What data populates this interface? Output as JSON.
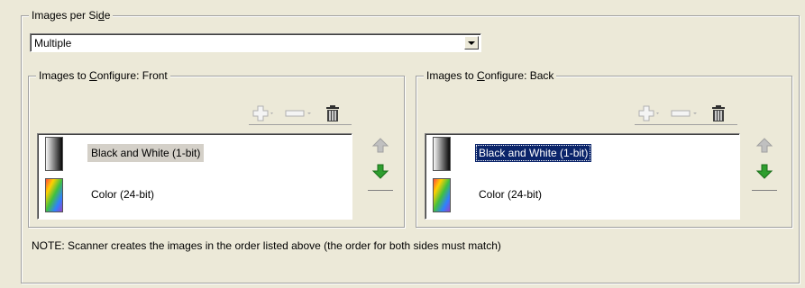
{
  "images_per_side": {
    "legend_prefix": "Images per Si",
    "legend_underline": "d",
    "legend_suffix": "e",
    "selected": "Multiple"
  },
  "front": {
    "legend_prefix": "Images to ",
    "legend_underline": "C",
    "legend_suffix": "onfigure: Front",
    "items": [
      {
        "label": "Black and White (1-bit)",
        "icon": "bw-image-icon"
      },
      {
        "label": "Color (24-bit)",
        "icon": "color-image-icon"
      }
    ]
  },
  "back": {
    "legend_prefix": "Images to ",
    "legend_underline": "C",
    "legend_suffix": "onfigure: Back",
    "items": [
      {
        "label": "Black and White (1-bit)",
        "icon": "bw-image-icon"
      },
      {
        "label": "Color (24-bit)",
        "icon": "color-image-icon"
      }
    ]
  },
  "note": "NOTE: Scanner creates the images in the order listed above (the order for both sides must match)",
  "colors": {
    "selection": "#0a246a",
    "arrow_down": "#2e9e2e",
    "arrow_up_disabled": "#b0b0b0"
  }
}
